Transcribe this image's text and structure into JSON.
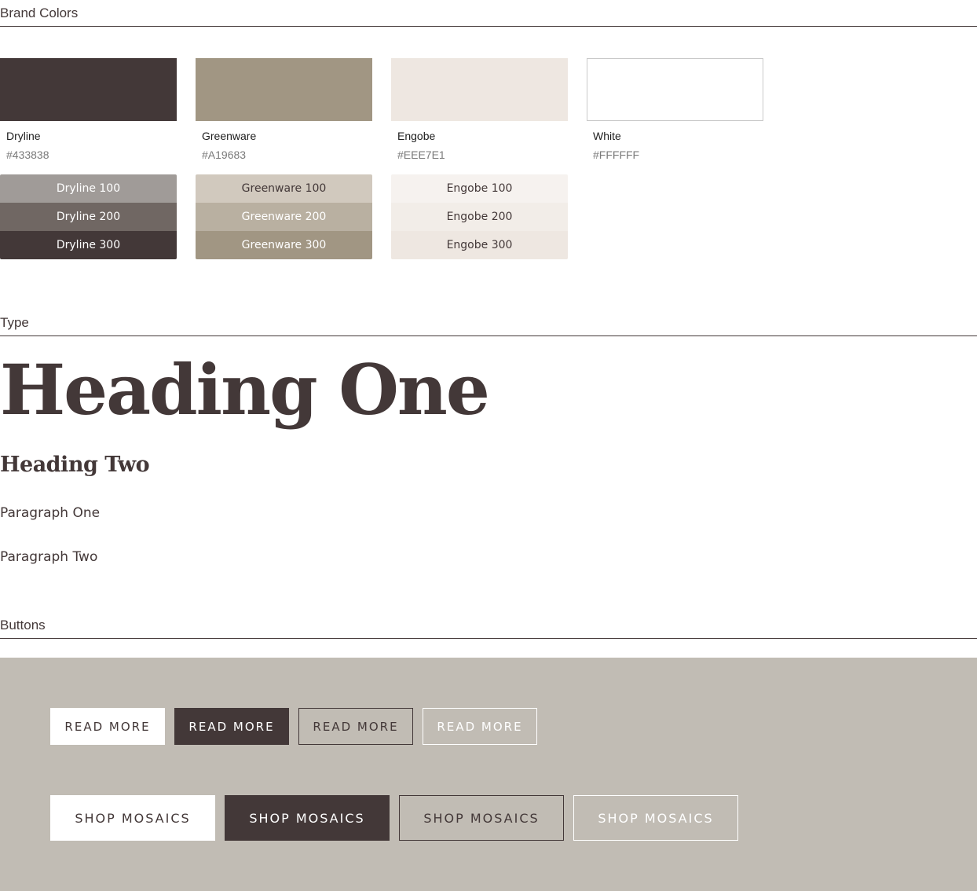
{
  "sections": {
    "brand_colors": "Brand Colors",
    "type": "Type",
    "buttons": "Buttons"
  },
  "brand_colors": [
    {
      "name": "Dryline",
      "hex": "#433838",
      "color": "#433838",
      "shades": [
        {
          "label": "Dryline 100",
          "bg": "#a09b98",
          "fg": "#ffffff"
        },
        {
          "label": "Dryline 200",
          "bg": "#706763",
          "fg": "#ffffff"
        },
        {
          "label": "Dryline 300",
          "bg": "#433838",
          "fg": "#ffffff"
        }
      ]
    },
    {
      "name": "Greenware",
      "hex": "#A19683",
      "color": "#A19683",
      "shades": [
        {
          "label": "Greenware 100",
          "bg": "#d1c9be",
          "fg": "#433838"
        },
        {
          "label": "Greenware 200",
          "bg": "#b9b0a1",
          "fg": "#ffffff"
        },
        {
          "label": "Greenware 300",
          "bg": "#A19683",
          "fg": "#ffffff"
        }
      ]
    },
    {
      "name": "Engobe",
      "hex": "#EEE7E1",
      "color": "#EEE7E1",
      "shades": [
        {
          "label": "Engobe 100",
          "bg": "#f6f2ef",
          "fg": "#433838"
        },
        {
          "label": "Engobe 200",
          "bg": "#f2ede8",
          "fg": "#433838"
        },
        {
          "label": "Engobe 300",
          "bg": "#EEE7E1",
          "fg": "#433838"
        }
      ]
    },
    {
      "name": "White",
      "hex": "#FFFFFF",
      "color": "#FFFFFF",
      "shades": []
    }
  ],
  "type": {
    "heading_one": "Heading One",
    "heading_two": "Heading Two",
    "paragraph_one": "Paragraph One",
    "paragraph_two": "Paragraph Two"
  },
  "buttons": {
    "small_label": "READ MORE",
    "large_label": "SHOP MOSAICS",
    "panel_color": "#c1bcb4"
  }
}
